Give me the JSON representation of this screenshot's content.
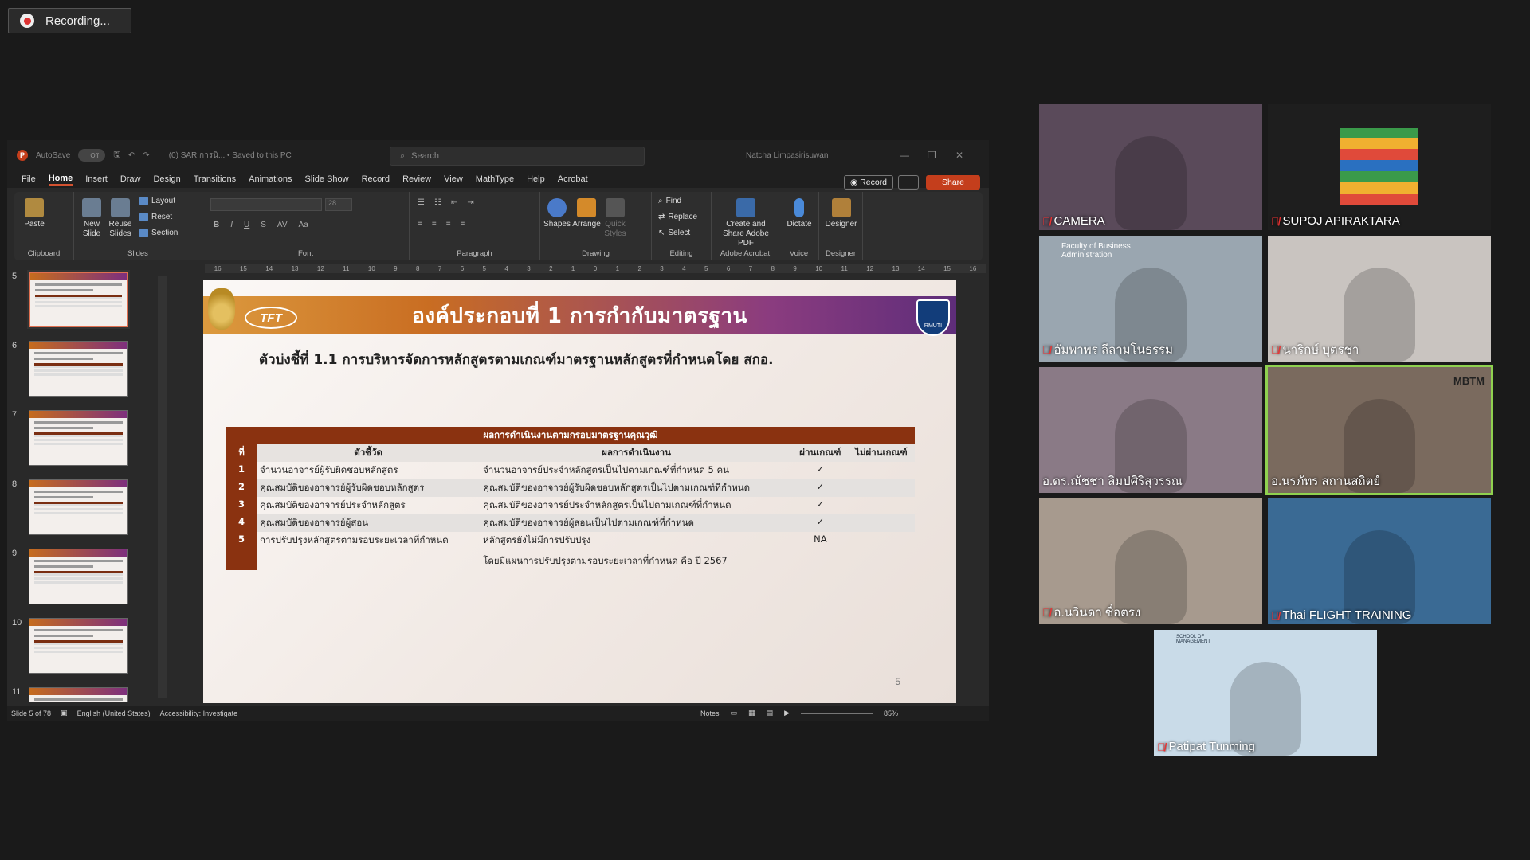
{
  "recording": {
    "label": "Recording..."
  },
  "ppt": {
    "title_bar": {
      "autosave": "AutoSave",
      "toggle": "Off",
      "doc": "(0) SAR การนิ... • Saved to this PC",
      "search_placeholder": "Search",
      "user": "Natcha Limpasirisuwan"
    },
    "menu": [
      "File",
      "Home",
      "Insert",
      "Draw",
      "Design",
      "Transitions",
      "Animations",
      "Slide Show",
      "Record",
      "Review",
      "View",
      "MathType",
      "Help",
      "Acrobat"
    ],
    "buttons": {
      "record": "Record",
      "share": "Share"
    },
    "ribbon": {
      "clipboard": {
        "paste": "Paste",
        "label": "Clipboard"
      },
      "slides": {
        "new_slide": "New Slide",
        "reuse": "Reuse Slides",
        "layout": "Layout",
        "reset": "Reset",
        "section": "Section",
        "label": "Slides"
      },
      "font": {
        "label": "Font",
        "size": "28"
      },
      "paragraph": {
        "label": "Paragraph"
      },
      "drawing": {
        "shapes": "Shapes",
        "arrange": "Arrange",
        "quick_styles": "Quick Styles",
        "label": "Drawing"
      },
      "editing": {
        "find": "Find",
        "replace": "Replace",
        "select": "Select",
        "label": "Editing"
      },
      "adobe": {
        "create": "Create and Share Adobe PDF",
        "label": "Adobe Acrobat"
      },
      "voice": {
        "dictate": "Dictate",
        "label": "Voice"
      },
      "designer": {
        "designer": "Designer",
        "label": "Designer"
      }
    },
    "thumb_numbers": [
      "5",
      "6",
      "7",
      "8",
      "9",
      "10",
      "11"
    ],
    "slide": {
      "title": "องค์ประกอบที่ 1 การกำกับมาตรฐาน",
      "logo_text": "TFT",
      "shield_text": "RMUTI",
      "indicator": "ตัวบ่งชี้ที่ 1.1  การบริหารจัดการหลักสูตรตามเกณฑ์มาตรฐานหลักสูตรที่กำหนดโดย สกอ.",
      "table": {
        "caption": "ผลการดำเนินงานตามกรอบมาตรฐานคุณวุฒิ",
        "headers": [
          "ที่",
          "ตัวชี้วัด",
          "ผลการดำเนินงาน",
          "ผ่านเกณฑ์",
          "ไม่ผ่านเกณฑ์"
        ],
        "rows": [
          {
            "no": "1",
            "indicator": "จำนวนอาจารย์ผู้รับผิดชอบหลักสูตร",
            "result": "จำนวนอาจารย์ประจำหลักสูตรเป็นไปตามเกณฑ์ที่กำหนด 5 คน",
            "pass": "✓",
            "fail": ""
          },
          {
            "no": "2",
            "indicator": "คุณสมบัติของอาจารย์ผู้รับผิดชอบหลักสูตร",
            "result": "คุณสมบัติของอาจารย์ผู้รับผิดชอบหลักสูตรเป็นไปตามเกณฑ์ที่กำหนด",
            "pass": "✓",
            "fail": ""
          },
          {
            "no": "3",
            "indicator": "คุณสมบัติของอาจารย์ประจำหลักสูตร",
            "result": "คุณสมบัติของอาจารย์ประจำหลักสูตรเป็นไปตามเกณฑ์ที่กำหนด",
            "pass": "✓",
            "fail": ""
          },
          {
            "no": "4",
            "indicator": "คุณสมบัติของอาจารย์ผู้สอน",
            "result": "คุณสมบัติของอาจารย์ผู้สอนเป็นไปตามเกณฑ์ที่กำหนด",
            "pass": "✓",
            "fail": ""
          },
          {
            "no": "5",
            "indicator": "การปรับปรุงหลักสูตรตามรอบระยะเวลาที่กำหนด",
            "result": "หลักสูตรยังไม่มีการปรับปรุง",
            "result2": "โดยมีแผนการปรับปรุงตามรอบระยะเวลาที่กำหนด คือ ปี 2567",
            "pass": "NA",
            "fail": ""
          }
        ]
      },
      "page": "5"
    },
    "status": {
      "slide": "Slide 5 of 78",
      "lang": "English (United States)",
      "access": "Accessibility: Investigate",
      "notes": "Notes",
      "zoom": "85%"
    }
  },
  "participants": [
    {
      "name": "CAMERA",
      "muted": true,
      "bg": "#5a4a5a"
    },
    {
      "name": "SUPOJ APIRAKTARA",
      "muted": true,
      "bg": "#1e1e1e"
    },
    {
      "name": "อัมพาพร ลีลามโนธรรม",
      "muted": true,
      "bg": "#9aa6b0"
    },
    {
      "name": "นาริกษ์ บุตรชา",
      "muted": true,
      "bg": "#c9c4c0"
    },
    {
      "name": "อ.ดร.ณัชชา ลิมปศิริสุวรรณ",
      "muted": false,
      "bg": "#8a7a86"
    },
    {
      "name": "อ.นรภัทร สถานสถิตย์",
      "muted": false,
      "bg": "#7a6a5e"
    },
    {
      "name": "อ.นวินดา ซื่อตรง",
      "muted": true,
      "bg": "#a79a8e"
    },
    {
      "name": "Thai FLIGHT TRAINING",
      "muted": true,
      "bg": "#3a6a94"
    },
    {
      "name": "Patipat Tunming",
      "muted": true,
      "bg": "#c9dbe8"
    }
  ],
  "tile_labels": {
    "faculty": "Faculty of Business Administration",
    "mbtm": "MBTM",
    "school": "SCHOOL OF MANAGEMENT"
  }
}
